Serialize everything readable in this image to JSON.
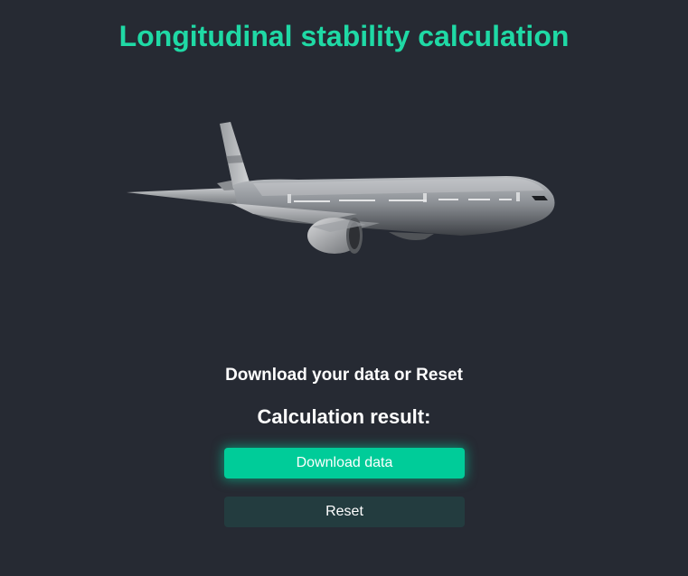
{
  "header": {
    "title": "Longitudinal stability calculation"
  },
  "hero": {
    "image": "airplane-illustration"
  },
  "main": {
    "subtitle": "Download your data or Reset",
    "result_heading": "Calculation result:"
  },
  "actions": {
    "download_label": "Download data",
    "reset_label": "Reset"
  },
  "colors": {
    "background": "#262a33",
    "accent": "#1fd9a5",
    "download_button": "#00cc99",
    "reset_button": "#233c3f"
  }
}
